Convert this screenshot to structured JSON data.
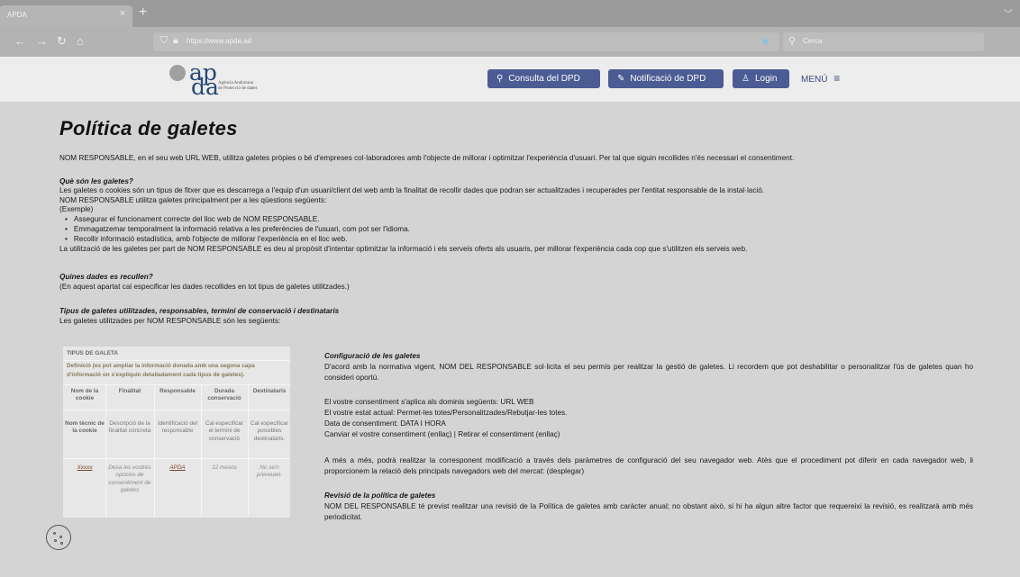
{
  "browser": {
    "tab_title": "APDA",
    "tab_close": "×",
    "new_tab": "+",
    "url": "https://www.apda.ad",
    "search_placeholder": "Cerca"
  },
  "header": {
    "logo_ap": "ap",
    "logo_da": "da",
    "logo_line1": "Agència Andorrana",
    "logo_line2": "de Protecció de dades",
    "btn_consulta": "Consulta del DPD",
    "btn_notificacio": "Notificació de DPD",
    "btn_login": "Login",
    "menu": "MENÚ"
  },
  "page": {
    "title": "Política de galetes",
    "intro": "NOM RESPONSABLE, en el seu web URL WEB, utilitza galetes pròpies o bé d'empreses col·laboradores amb l'objecte de millorar i optimitzar l'experiència d'usuari. Per tal que siguin recollides n'és necessari el consentiment.",
    "q1_title": "Què són les galetes?",
    "q1_p1": "Les galetes o cookies són un tipus de fitxer que es descarrega a l'equip d'un usuari/client del web amb la finalitat de recollir dades que podran ser actualitzades i recuperades per l'entitat responsable de la instal·lació.",
    "q1_p2": "NOM RESPONSABLE utilitza galetes principalment per a les qüestions següents:",
    "q1_p3": "(Exemple)",
    "q1_bullets": [
      "Assegurar el funcionament correcte del lloc web de NOM RESPONSABLE.",
      "Emmagatzemar temporalment la informació relativa a les preferències de l'usuari, com pot ser l'idioma.",
      "Recollir informació estadística, amb l'objecte de millorar l'experiència en el lloc web."
    ],
    "q1_p4": "La utilització de les galetes per part de NOM RESPONSABLE es deu al propòsit d'intentar optimitzar la informació i els serveis oferts als usuaris, per millorar l'experiència cada cop que s'utilitzen els serveis web.",
    "q2_title": "Quines dades es recullen?",
    "q2_p1": "(En aquest apartat cal especificar les dades recollides en tot tipus de galetes utilitzades.)",
    "q3_title": "Tipus de galetes utilitzades, responsables, termini de conservació i destinataris",
    "q3_p1": "Les galetes utilitzades per NOM RESPONSABLE són les següents:"
  },
  "table": {
    "caption": "TIPUS DE GALETA",
    "def1": "Definició (es pot ampliar la informació donada amb una segona capa",
    "def2": "d'informació on s'expliquin detalladament cada tipus de galetes).",
    "headers": [
      "Nom de la cookie",
      "Finalitat",
      "Responsable",
      "Durada conservació",
      "Destinataris"
    ],
    "row1": [
      "Nom tècnic de la cookie",
      "Descripció de la finalitat concreta",
      "Identificació del responsable",
      "Cal especificar el termini de conservació",
      "Cal especificar possibles destinataris."
    ],
    "row2": [
      "Xxxxx",
      "Desa les vostres opcions de consentiment de galetes",
      "APDA",
      "12 mesos",
      "No se'n preveuen."
    ]
  },
  "config": {
    "title": "Configuració de les galetes",
    "p1": "D'acord amb la normativa vigent, NOM DEL RESPONSABLE sol·licita el seu permís per realitzar la gestió de galetes. Li recordem que pot deshabilitar o personalitzar l'ús de galetes quan ho consideri oportú.",
    "l1": "El vostre consentiment s'aplica als dominis següents: URL WEB",
    "l2": "El vostre estat actual: Permet-les totes/Personalitzades/Rebutjar-les totes.",
    "l3": "Data de consentiment: DATA I HORA",
    "l4": "Canviar el vostre consentiment (enllaç) |  Retirar el consentiment (enllaç)",
    "p2": "A més a més, podrà realitzar la corresponent modificació a través dels paràmetres de configuració del seu navegador web. Atès que el procediment pot diferir en cada navegador web, li proporcionem la relació dels principals navegadors web del mercat: (desplegar)",
    "rev_title": "Revisió de la política de galetes",
    "rev_p": "NOM DEL RESPONSABLE té previst realitzar una revisió de la Política de galetes amb caràcter anual; no obstant això, si hi ha algun altre factor que requereixi la revisió, es realitzarà amb més periodicitat."
  }
}
